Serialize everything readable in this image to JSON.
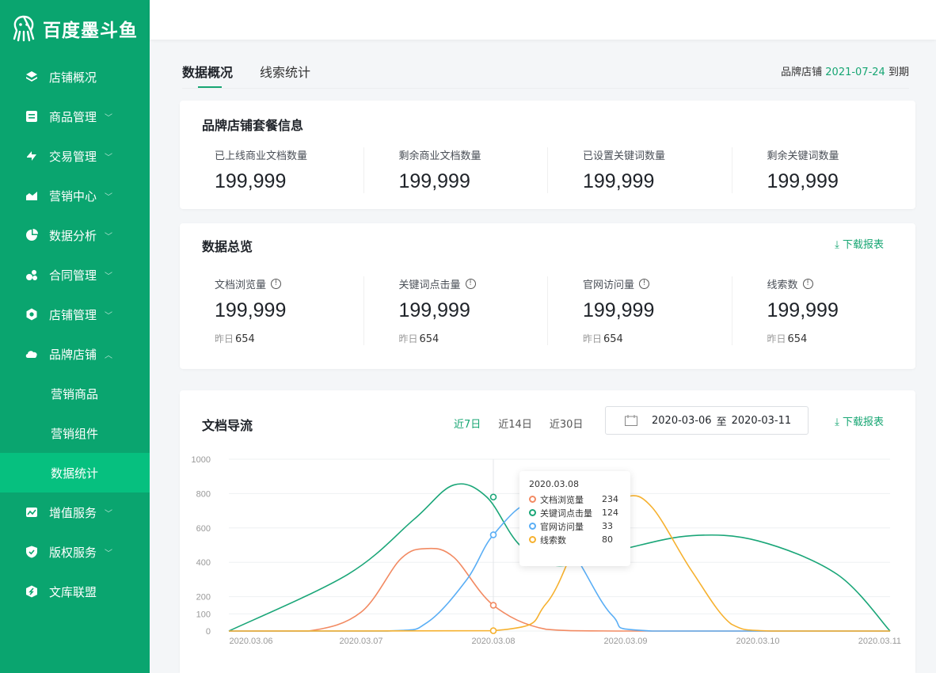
{
  "logo": {
    "text": "百度墨斗鱼"
  },
  "menu": [
    {
      "label": "店铺概况",
      "icon": "layers-icon",
      "chevron": false
    },
    {
      "label": "商品管理",
      "icon": "list-icon",
      "chevron": true
    },
    {
      "label": "交易管理",
      "icon": "exchange-icon",
      "chevron": true
    },
    {
      "label": "营销中心",
      "icon": "trend-icon",
      "chevron": true
    },
    {
      "label": "数据分析",
      "icon": "pie-icon",
      "chevron": true
    },
    {
      "label": "合同管理",
      "icon": "contract-icon",
      "chevron": true
    },
    {
      "label": "店铺管理",
      "icon": "hexagon-icon",
      "chevron": true
    },
    {
      "label": "品牌店铺",
      "icon": "cloud-icon",
      "chevron": true,
      "expanded": true
    }
  ],
  "submenu": [
    {
      "label": "营销商品"
    },
    {
      "label": "营销组件"
    },
    {
      "label": "数据统计",
      "active": true
    }
  ],
  "menu_bottom": [
    {
      "label": "增值服务",
      "icon": "chart-icon",
      "chevron": true
    },
    {
      "label": "版权服务",
      "icon": "shield-icon",
      "chevron": true
    },
    {
      "label": "文库联盟",
      "icon": "union-icon",
      "chevron": false
    }
  ],
  "tabs": [
    {
      "label": "数据概况",
      "active": true
    },
    {
      "label": "线索统计",
      "active": false
    }
  ],
  "expiry": {
    "prefix": "品牌店铺",
    "date": "2021-07-24",
    "suffix": "到期"
  },
  "package": {
    "title": "品牌店铺套餐信息",
    "stats": [
      {
        "label": "已上线商业文档数量",
        "value": "199,999"
      },
      {
        "label": "剩余商业文档数量",
        "value": "199,999"
      },
      {
        "label": "已设置关键词数量",
        "value": "199,999"
      },
      {
        "label": "剩余关键词数量",
        "value": "199,999"
      }
    ]
  },
  "overview": {
    "title": "数据总览",
    "download": "下载报表",
    "stats": [
      {
        "label": "文档浏览量",
        "value": "199,999",
        "yest_label": "昨日",
        "yest": "654"
      },
      {
        "label": "关键词点击量",
        "value": "199,999",
        "yest_label": "昨日",
        "yest": "654"
      },
      {
        "label": "官网访问量",
        "value": "199,999",
        "yest_label": "昨日",
        "yest": "654"
      },
      {
        "label": "线索数",
        "value": "199,999",
        "yest_label": "昨日",
        "yest": "654"
      }
    ]
  },
  "flow": {
    "title": "文档导流",
    "ranges": [
      {
        "label": "近7日",
        "active": true
      },
      {
        "label": "近14日",
        "active": false
      },
      {
        "label": "近30日",
        "active": false
      }
    ],
    "date_from": "2020-03-06",
    "date_sep": "至",
    "date_to": "2020-03-11",
    "download": "下载报表",
    "tooltip": {
      "title": "2020.03.08",
      "rows": [
        {
          "name": "文档浏览量",
          "value": "234",
          "color": "#f28a62"
        },
        {
          "name": "关键词点击量",
          "value": "124",
          "color": "#1aa678"
        },
        {
          "name": "官网访问量",
          "value": "33",
          "color": "#5aaef5"
        },
        {
          "name": "线索数",
          "value": "80",
          "color": "#f6b12f"
        }
      ]
    }
  },
  "chart_data": {
    "type": "line",
    "x": [
      "2020.03.06",
      "2020.03.07",
      "2020.03.08",
      "2020.03.09",
      "2020.03.10",
      "2020.03.11"
    ],
    "yticks": [
      0,
      100,
      200,
      400,
      600,
      800,
      1000
    ],
    "ylim": [
      0,
      1000
    ],
    "grid": true,
    "series": [
      {
        "name": "文档浏览量",
        "color": "#f28a62",
        "points": [
          [
            0,
            0
          ],
          [
            0.6,
            0
          ],
          [
            1.0,
            110
          ],
          [
            1.3,
            420
          ],
          [
            1.5,
            480
          ],
          [
            1.7,
            430
          ],
          [
            2.0,
            150
          ],
          [
            2.4,
            10
          ],
          [
            3.0,
            0
          ],
          [
            5.0,
            0
          ]
        ]
      },
      {
        "name": "关键词点击量",
        "color": "#1aa678",
        "points": [
          [
            0,
            0
          ],
          [
            0.9,
            330
          ],
          [
            1.4,
            650
          ],
          [
            1.7,
            850
          ],
          [
            1.95,
            780
          ],
          [
            2.2,
            500
          ],
          [
            2.5,
            380
          ],
          [
            3.0,
            480
          ],
          [
            3.5,
            555
          ],
          [
            4.0,
            525
          ],
          [
            4.6,
            330
          ],
          [
            5.0,
            0
          ]
        ]
      },
      {
        "name": "官网访问量",
        "color": "#5aaef5",
        "points": [
          [
            0,
            0
          ],
          [
            1.2,
            0
          ],
          [
            1.5,
            50
          ],
          [
            1.8,
            300
          ],
          [
            2.0,
            560
          ],
          [
            2.3,
            740
          ],
          [
            2.6,
            460
          ],
          [
            2.9,
            90
          ],
          [
            3.2,
            0
          ],
          [
            5.0,
            0
          ]
        ]
      },
      {
        "name": "线索数",
        "color": "#f6b12f",
        "points": [
          [
            0,
            0
          ],
          [
            2.0,
            2
          ],
          [
            2.4,
            160
          ],
          [
            2.7,
            620
          ],
          [
            3.0,
            780
          ],
          [
            3.2,
            720
          ],
          [
            3.5,
            350
          ],
          [
            3.8,
            40
          ],
          [
            4.1,
            0
          ],
          [
            5.0,
            0
          ]
        ]
      }
    ],
    "markers_x": 2,
    "markers": [
      {
        "color": "#f28a62",
        "y": 150
      },
      {
        "color": "#1aa678",
        "y": 780
      },
      {
        "color": "#5aaef5",
        "y": 560
      },
      {
        "color": "#f6b12f",
        "y": 2
      }
    ]
  }
}
